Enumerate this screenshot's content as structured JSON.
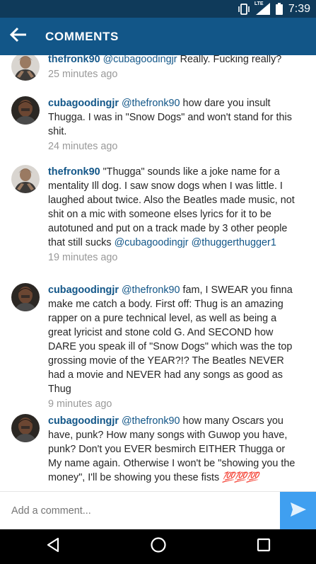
{
  "status_bar": {
    "network_label": "LTE",
    "time": "7:39",
    "icons": [
      "vibrate-icon",
      "signal-icon",
      "battery-icon"
    ]
  },
  "header": {
    "title": "COMMENTS",
    "back_icon": "arrow-left-icon"
  },
  "comments": [
    {
      "username": "thefronk90",
      "segments": [
        {
          "text": "@cubagoodingjr",
          "kind": "mention"
        },
        {
          "text": " Really. Fucking really?",
          "kind": "text"
        }
      ],
      "time": "25 minutes ago"
    },
    {
      "username": "cubagoodingjr",
      "segments": [
        {
          "text": "@thefronk90",
          "kind": "mention"
        },
        {
          "text": " how dare you insult Thugga. I was in \"Snow Dogs\" and won't stand for this shit.",
          "kind": "text"
        }
      ],
      "time": "24 minutes ago"
    },
    {
      "username": "thefronk90",
      "segments": [
        {
          "text": "\"Thugga\" sounds like a joke name for a mentality Ill dog. I saw snow dogs when I was little. I laughed about twice. Also the Beatles made music, not shit on a mic with someone elses lyrics for it to be autotuned and put on a track made by 3 other people that still sucks ",
          "kind": "text"
        },
        {
          "text": "@cubagoodingjr",
          "kind": "mention"
        },
        {
          "text": " ",
          "kind": "text"
        },
        {
          "text": "@thuggerthugger1",
          "kind": "mention"
        }
      ],
      "time": "19 minutes ago"
    },
    {
      "username": "cubagoodingjr",
      "segments": [
        {
          "text": "@thefronk90",
          "kind": "mention"
        },
        {
          "text": " fam, I SWEAR you finna make me catch a body. First off: Thug is an amazing rapper on a pure technical level, as well as being a great lyricist and stone cold G. And SECOND how DARE you speak ill of \"Snow Dogs\" which was the top grossing movie of the YEAR?!? The Beatles NEVER had a movie and NEVER had any songs as good as Thug",
          "kind": "text"
        }
      ],
      "time": "9 minutes ago"
    },
    {
      "username": "cubagoodingjr",
      "segments": [
        {
          "text": "@thefronk90",
          "kind": "mention"
        },
        {
          "text": " how many Oscars you have, punk? How many songs with Guwop you have, punk? Don't you EVER besmirch EITHER Thugga or My name again. Otherwise I won't be \"showing you the money\", I'll be showing you these fists ",
          "kind": "text"
        },
        {
          "text": "💯💯💯",
          "kind": "emoji"
        }
      ],
      "time": ""
    }
  ],
  "composer": {
    "placeholder": "Add a comment...",
    "send_icon": "send-icon"
  },
  "nav_bar": {
    "back_icon": "nav-back-icon",
    "home_icon": "nav-home-icon",
    "recents_icon": "nav-recents-icon"
  }
}
